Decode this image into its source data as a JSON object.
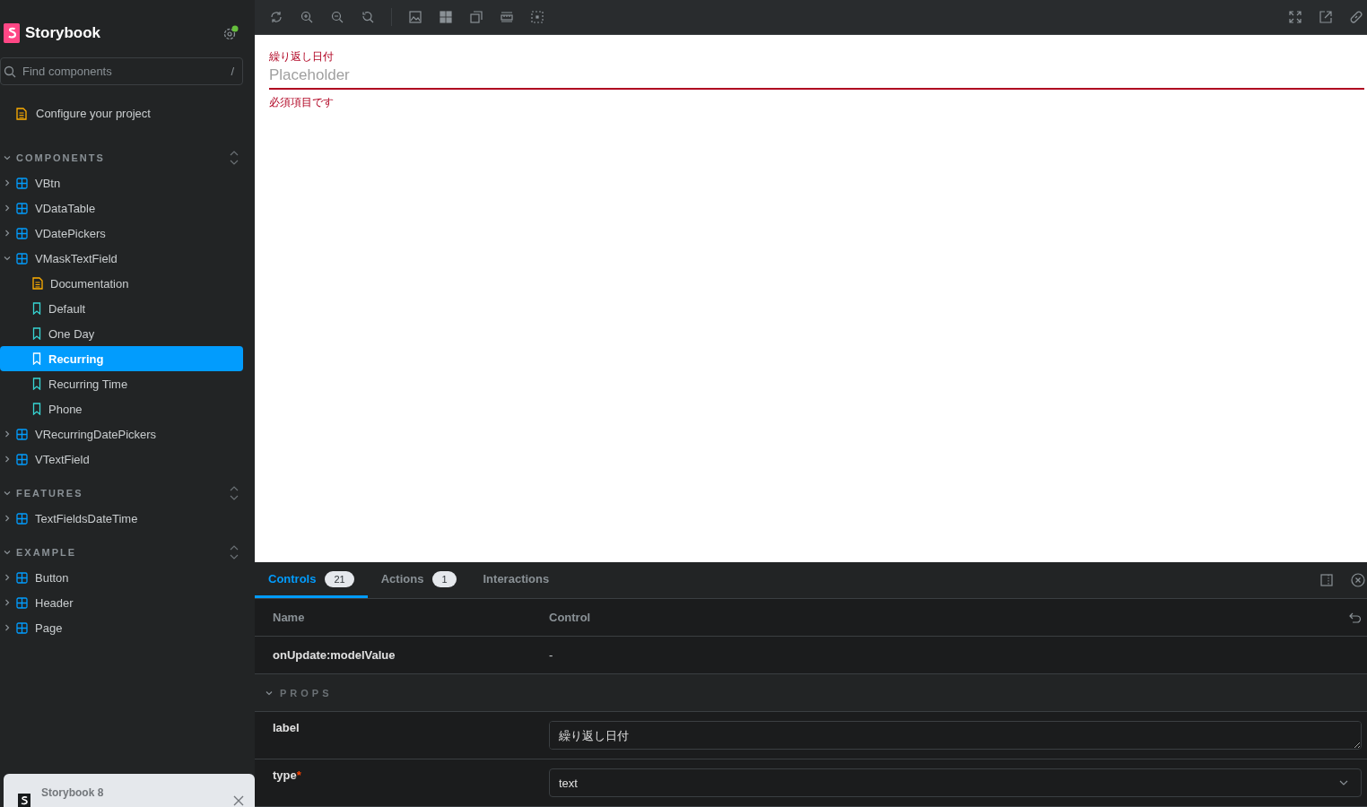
{
  "sidebar": {
    "brand": "Storybook",
    "search": {
      "placeholder": "Find components",
      "shortcut": "/"
    },
    "top_items": [
      {
        "kind": "docs",
        "label": "Configure your project"
      }
    ],
    "sections": [
      {
        "title": "COMPONENTS",
        "expanded": true,
        "items": [
          {
            "kind": "component",
            "label": "VBtn",
            "expanded": false,
            "selected": false
          },
          {
            "kind": "component",
            "label": "VDataTable",
            "expanded": false,
            "selected": false
          },
          {
            "kind": "component",
            "label": "VDatePickers",
            "expanded": false,
            "selected": false
          },
          {
            "kind": "component",
            "label": "VMaskTextField",
            "expanded": true,
            "selected": false,
            "children": [
              {
                "kind": "docs",
                "label": "Documentation",
                "selected": false
              },
              {
                "kind": "story",
                "label": "Default",
                "selected": false
              },
              {
                "kind": "story",
                "label": "One Day",
                "selected": false
              },
              {
                "kind": "story",
                "label": "Recurring",
                "selected": true
              },
              {
                "kind": "story",
                "label": "Recurring Time",
                "selected": false
              },
              {
                "kind": "story",
                "label": "Phone",
                "selected": false
              }
            ]
          },
          {
            "kind": "component",
            "label": "VRecurringDatePickers",
            "expanded": false,
            "selected": false
          },
          {
            "kind": "component",
            "label": "VTextField",
            "expanded": false,
            "selected": false
          }
        ]
      },
      {
        "title": "FEATURES",
        "expanded": true,
        "items": [
          {
            "kind": "component",
            "label": "TextFieldsDateTime",
            "expanded": false,
            "selected": false
          }
        ]
      },
      {
        "title": "EXAMPLE",
        "expanded": true,
        "items": [
          {
            "kind": "component",
            "label": "Button",
            "expanded": false,
            "selected": false
          },
          {
            "kind": "component",
            "label": "Header",
            "expanded": false,
            "selected": false
          },
          {
            "kind": "component",
            "label": "Page",
            "expanded": false,
            "selected": false
          }
        ]
      }
    ]
  },
  "notification": {
    "title": "Storybook 8"
  },
  "preview": {
    "field": {
      "label": "繰り返し日付",
      "placeholder": "Placeholder",
      "error": "必須項目です"
    }
  },
  "panel": {
    "tabs": [
      {
        "label": "Controls",
        "count": "21",
        "selected": true
      },
      {
        "label": "Actions",
        "count": "1",
        "selected": false
      },
      {
        "label": "Interactions",
        "selected": false
      }
    ],
    "columns": [
      "Name",
      "Control"
    ],
    "rows": [
      {
        "kind": "plain",
        "name": "onUpdate:modelValue",
        "value": "-"
      },
      {
        "kind": "section",
        "name": "PROPS",
        "expanded": true
      },
      {
        "kind": "text",
        "name": "label",
        "value": "繰り返し日付"
      },
      {
        "kind": "select",
        "name": "type",
        "required_mark": "*",
        "value": "text"
      }
    ]
  }
}
